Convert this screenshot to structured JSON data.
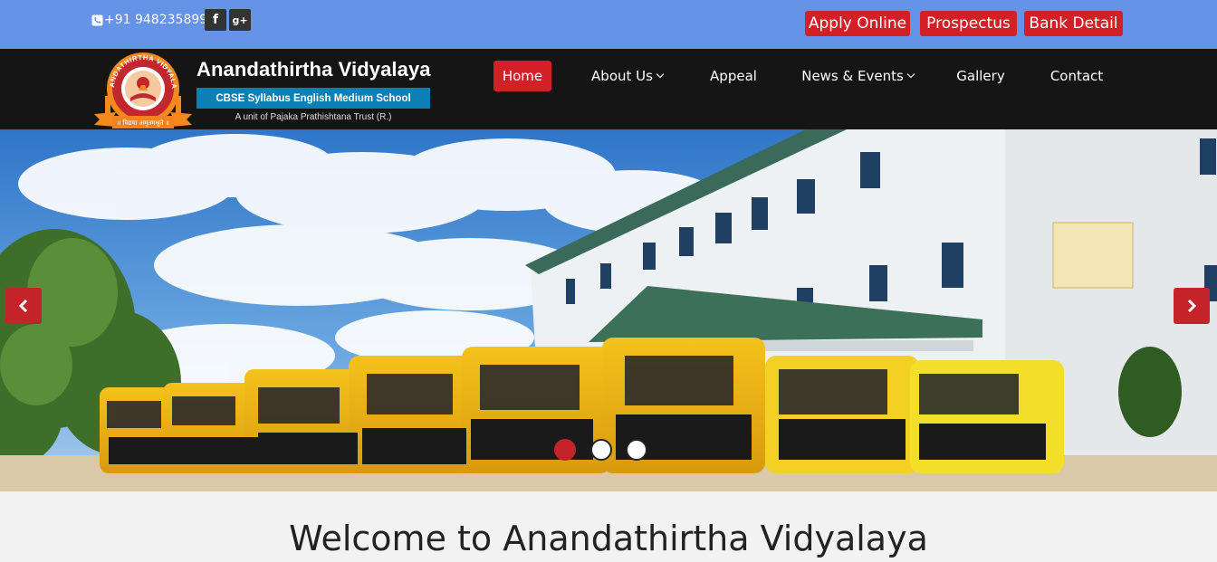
{
  "topbar": {
    "phone": "+91 9482358995",
    "facebook_icon": "f",
    "googleplus_icon": "g+",
    "buttons": [
      "Apply Online",
      "Prospectus",
      "Bank Detail"
    ]
  },
  "brand": {
    "name": "Anandathirtha Vidyalaya",
    "tagline": "CBSE Syllabus English Medium School",
    "unit": "A unit of Pajaka Prathishtana Trust (R.)",
    "logo_ring_text": "ANANDATHIRTHA VIDYALAYA",
    "logo_ribbon_text": "॥ विद्यया अमृतमश्नुते ॥"
  },
  "nav": {
    "items": [
      "Home",
      "About Us",
      "Appeal",
      "News & Events",
      "Gallery",
      "Contact"
    ],
    "active": "Home"
  },
  "hero": {
    "slides_count": 3,
    "active_slide": 1
  },
  "welcome": "Welcome to Anandathirtha Vidyalaya",
  "colors": {
    "topbar": "#6493e8",
    "navbar": "#151515",
    "accent": "#d32026",
    "tagline_bg": "#0c7fb5"
  }
}
